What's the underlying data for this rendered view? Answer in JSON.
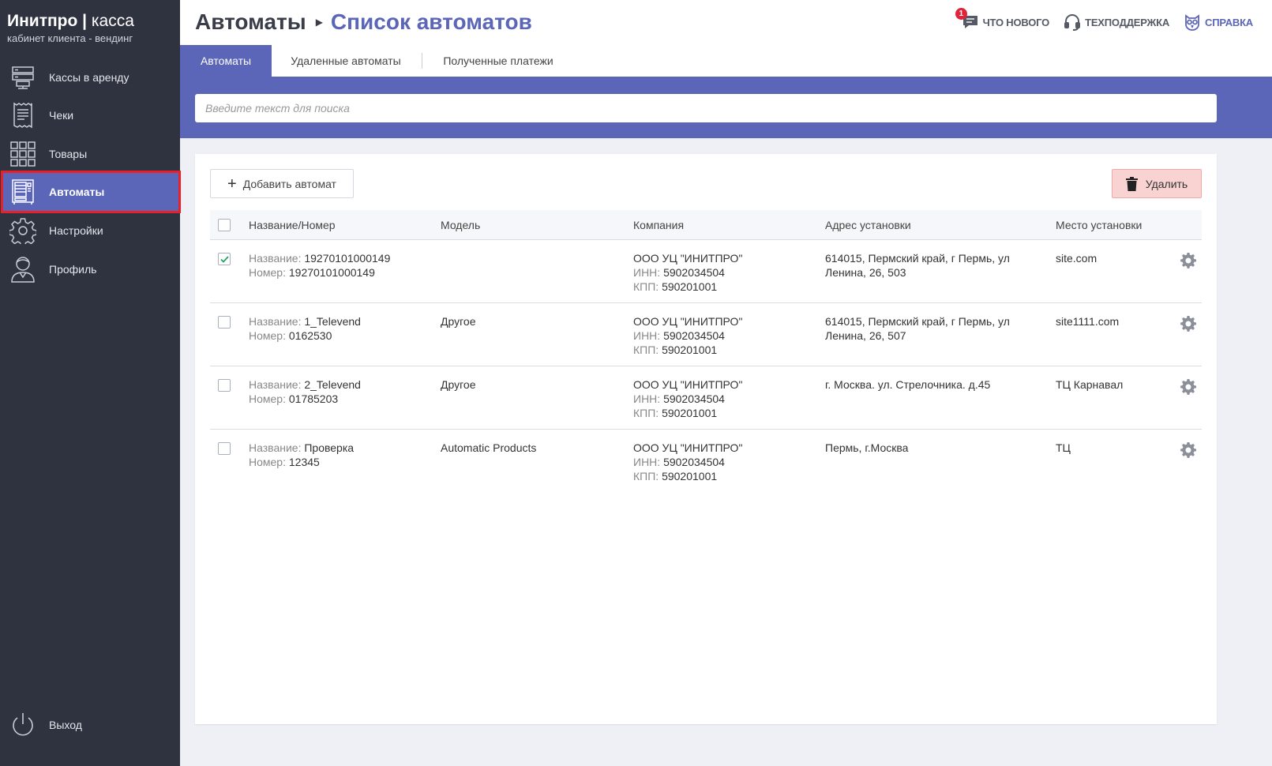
{
  "brand": {
    "title_bold": "Инитпро",
    "separator": "|",
    "title_light": "касса",
    "subtitle": "кабинет клиента - вендинг"
  },
  "sidebar": {
    "items": [
      {
        "label": "Кассы в аренду",
        "icon": "server-icon"
      },
      {
        "label": "Чеки",
        "icon": "receipt-icon"
      },
      {
        "label": "Товары",
        "icon": "grid-icon"
      },
      {
        "label": "Автоматы",
        "icon": "vending-machine-icon",
        "active": true
      },
      {
        "label": "Настройки",
        "icon": "gear-icon"
      },
      {
        "label": "Профиль",
        "icon": "user-icon"
      }
    ],
    "logout": "Выход"
  },
  "header": {
    "breadcrumb_root": "Автоматы",
    "breadcrumb_current": "Список автоматов",
    "links": {
      "news": "ЧТО НОВОГО",
      "news_badge": "1",
      "support": "ТЕХПОДДЕРЖКА",
      "help": "СПРАВКА"
    }
  },
  "tabs": [
    "Автоматы",
    "Удаленные автоматы",
    "Полученные платежи"
  ],
  "search": {
    "placeholder": "Введите текст для поиска",
    "value": ""
  },
  "toolbar": {
    "add_label": "Добавить автомат",
    "delete_label": "Удалить"
  },
  "table": {
    "columns": [
      "Название/Номер",
      "Модель",
      "Компания",
      "Адрес установки",
      "Место установки"
    ],
    "name_label": "Название:",
    "number_label": "Номер:",
    "inn_label": "ИНН:",
    "kpp_label": "КПП:",
    "rows": [
      {
        "checked": true,
        "name": "19270101000149",
        "number": "19270101000149",
        "model": "",
        "company": "ООО УЦ \"ИНИТПРО\"",
        "inn": "5902034504",
        "kpp": "590201001",
        "address1": "614015, Пермский край, г Пермь, ул",
        "address2": "Ленина, 26, 503",
        "place": "site.com"
      },
      {
        "checked": false,
        "name": "1_Televend",
        "number": "0162530",
        "model": "Другое",
        "company": "ООО УЦ \"ИНИТПРО\"",
        "inn": "5902034504",
        "kpp": "590201001",
        "address1": "614015, Пермский край, г Пермь, ул",
        "address2": "Ленина, 26, 507",
        "place": "site1111.com"
      },
      {
        "checked": false,
        "name": "2_Televend",
        "number": "01785203",
        "model": "Другое",
        "company": "ООО УЦ \"ИНИТПРО\"",
        "inn": "5902034504",
        "kpp": "590201001",
        "address1": "г. Москва. ул. Стрелочника. д.45",
        "address2": "",
        "place": "ТЦ Карнавал"
      },
      {
        "checked": false,
        "name": "Проверка",
        "number": "12345",
        "model": "Automatic Products",
        "company": "ООО УЦ \"ИНИТПРО\"",
        "inn": "5902034504",
        "kpp": "590201001",
        "address1": "Пермь, г.Москва",
        "address2": "",
        "place": "ТЦ"
      }
    ]
  },
  "colors": {
    "accent": "#5b66b8",
    "sidebar": "#2f3340",
    "highlight": "#e8202a",
    "delete_bg": "#f9d2d2",
    "badge": "#e0243a"
  }
}
